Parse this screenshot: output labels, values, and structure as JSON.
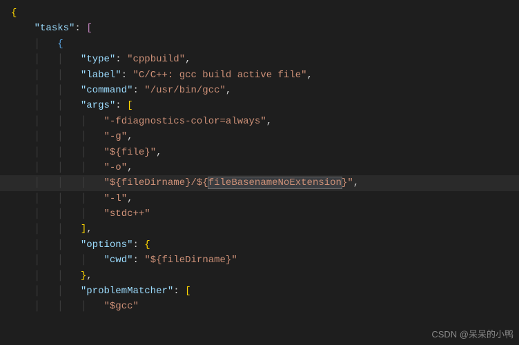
{
  "code": {
    "l1": "{",
    "l2_key": "\"tasks\"",
    "l2_colon": ": ",
    "l2_bracket": "[",
    "l3": "{",
    "l4_key": "\"type\"",
    "l4_val": "\"cppbuild\"",
    "l5_key": "\"label\"",
    "l5_val": "\"C/C++: gcc build active file\"",
    "l6_key": "\"command\"",
    "l6_val": "\"/usr/bin/gcc\"",
    "l7_key": "\"args\"",
    "l7_bracket": "[",
    "l8_val": "\"-fdiagnostics-color=always\"",
    "l9_val": "\"-g\"",
    "l10_val": "\"${file}\"",
    "l11_val": "\"-o\"",
    "l12_val_pre": "\"${fileDirname}/${",
    "l12_val_sel": "fileBasenameNoExtension",
    "l12_val_post": "}\"",
    "l13_val": "\"-l\"",
    "l14_val": "\"stdc++\"",
    "l15_bracket": "]",
    "l16_key": "\"options\"",
    "l16_brace": "{",
    "l17_key": "\"cwd\"",
    "l17_val": "\"${fileDirname}\"",
    "l18_brace": "}",
    "l19_key": "\"problemMatcher\"",
    "l19_bracket": "[",
    "l20_val": "\"$gcc\"",
    "comma": ",",
    "colon": ": "
  },
  "watermark": "CSDN @呆呆的小鸭"
}
